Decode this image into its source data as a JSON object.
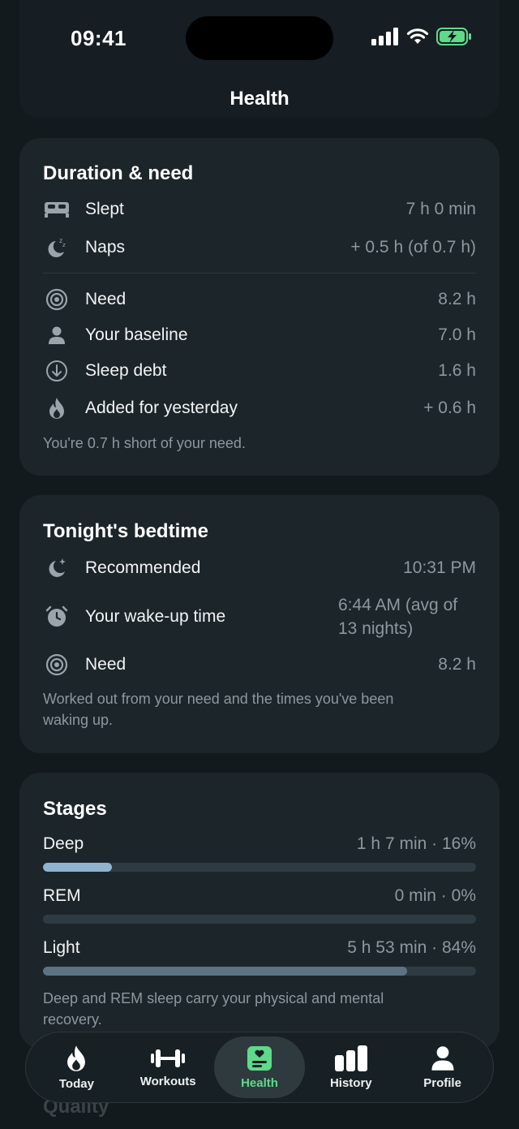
{
  "status_bar": {
    "time": "09:41"
  },
  "header": {
    "title": "Health"
  },
  "duration_card": {
    "title": "Duration & need",
    "rows": [
      {
        "icon": "bed-icon",
        "label": "Slept",
        "value": "7 h 0 min"
      },
      {
        "icon": "moon-zzz-icon",
        "label": "Naps",
        "value": "+ 0.5 h (of 0.7 h)"
      },
      {
        "icon": "target-icon",
        "label": "Need",
        "value": "8.2 h"
      },
      {
        "icon": "person-icon",
        "label": "Your baseline",
        "value": "7.0 h"
      },
      {
        "icon": "arrow-down-circle-icon",
        "label": "Sleep debt",
        "value": "1.6 h"
      },
      {
        "icon": "flame-icon",
        "label": "Added for yesterday",
        "value": "+ 0.6 h"
      }
    ],
    "note": "You're 0.7 h short of your need."
  },
  "bedtime_card": {
    "title": "Tonight's bedtime",
    "rows": [
      {
        "icon": "moon-stars-icon",
        "label": "Recommended",
        "value": "10:31 PM"
      },
      {
        "icon": "alarm-clock-icon",
        "label": "Your wake-up time",
        "value": "6:44 AM (avg of 13 nights)"
      },
      {
        "icon": "target-icon",
        "label": "Need",
        "value": "8.2 h"
      }
    ],
    "note": "Worked out from your need and the times you've been waking up."
  },
  "stages_card": {
    "title": "Stages",
    "stages": [
      {
        "label": "Deep",
        "value": "1 h 7 min · 16%",
        "fraction": 0.16,
        "color": "#8fb4d0"
      },
      {
        "label": "REM",
        "value": "0 min · 0%",
        "fraction": 0.0,
        "color": "#8fb4d0"
      },
      {
        "label": "Light",
        "value": "5 h 53 min · 84%",
        "fraction": 0.84,
        "color": "#5d7384"
      }
    ],
    "note": "Deep and REM sleep carry your physical and mental recovery."
  },
  "next_section": {
    "title": "Quality"
  },
  "tabbar": {
    "active": "Health",
    "accent": "#5fd98a",
    "tabs": [
      {
        "icon": "flame-icon",
        "label": "Today"
      },
      {
        "icon": "dumbbell-icon",
        "label": "Workouts"
      },
      {
        "icon": "health-icon",
        "label": "Health"
      },
      {
        "icon": "bar-chart-icon",
        "label": "History"
      },
      {
        "icon": "person-icon",
        "label": "Profile"
      }
    ]
  }
}
